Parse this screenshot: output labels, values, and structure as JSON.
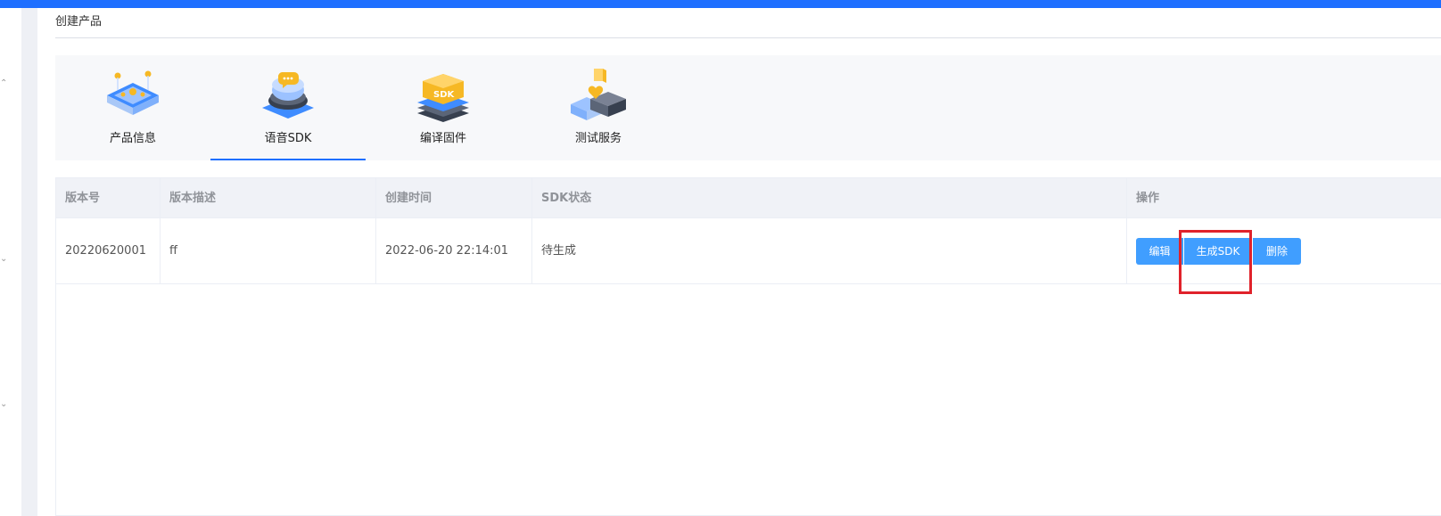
{
  "page": {
    "title": "创建产品"
  },
  "steps": [
    {
      "label": "产品信息",
      "icon": "product-info-icon",
      "active": false
    },
    {
      "label": "语音SDK",
      "icon": "voice-sdk-icon",
      "active": true
    },
    {
      "label": "编译固件",
      "icon": "compile-firmware-icon",
      "active": false
    },
    {
      "label": "测试服务",
      "icon": "test-service-icon",
      "active": false
    }
  ],
  "table": {
    "headers": [
      "版本号",
      "版本描述",
      "创建时间",
      "SDK状态",
      "操作"
    ],
    "rows": [
      {
        "version": "20220620001",
        "description": "ff",
        "created_at": "2022-06-20 22:14:01",
        "sdk_status": "待生成",
        "actions": {
          "edit": "编辑",
          "generate": "生成SDK",
          "delete": "删除"
        }
      }
    ]
  },
  "colors": {
    "accent": "#1e6fff",
    "button": "#409eff",
    "highlight": "#e0222b"
  }
}
